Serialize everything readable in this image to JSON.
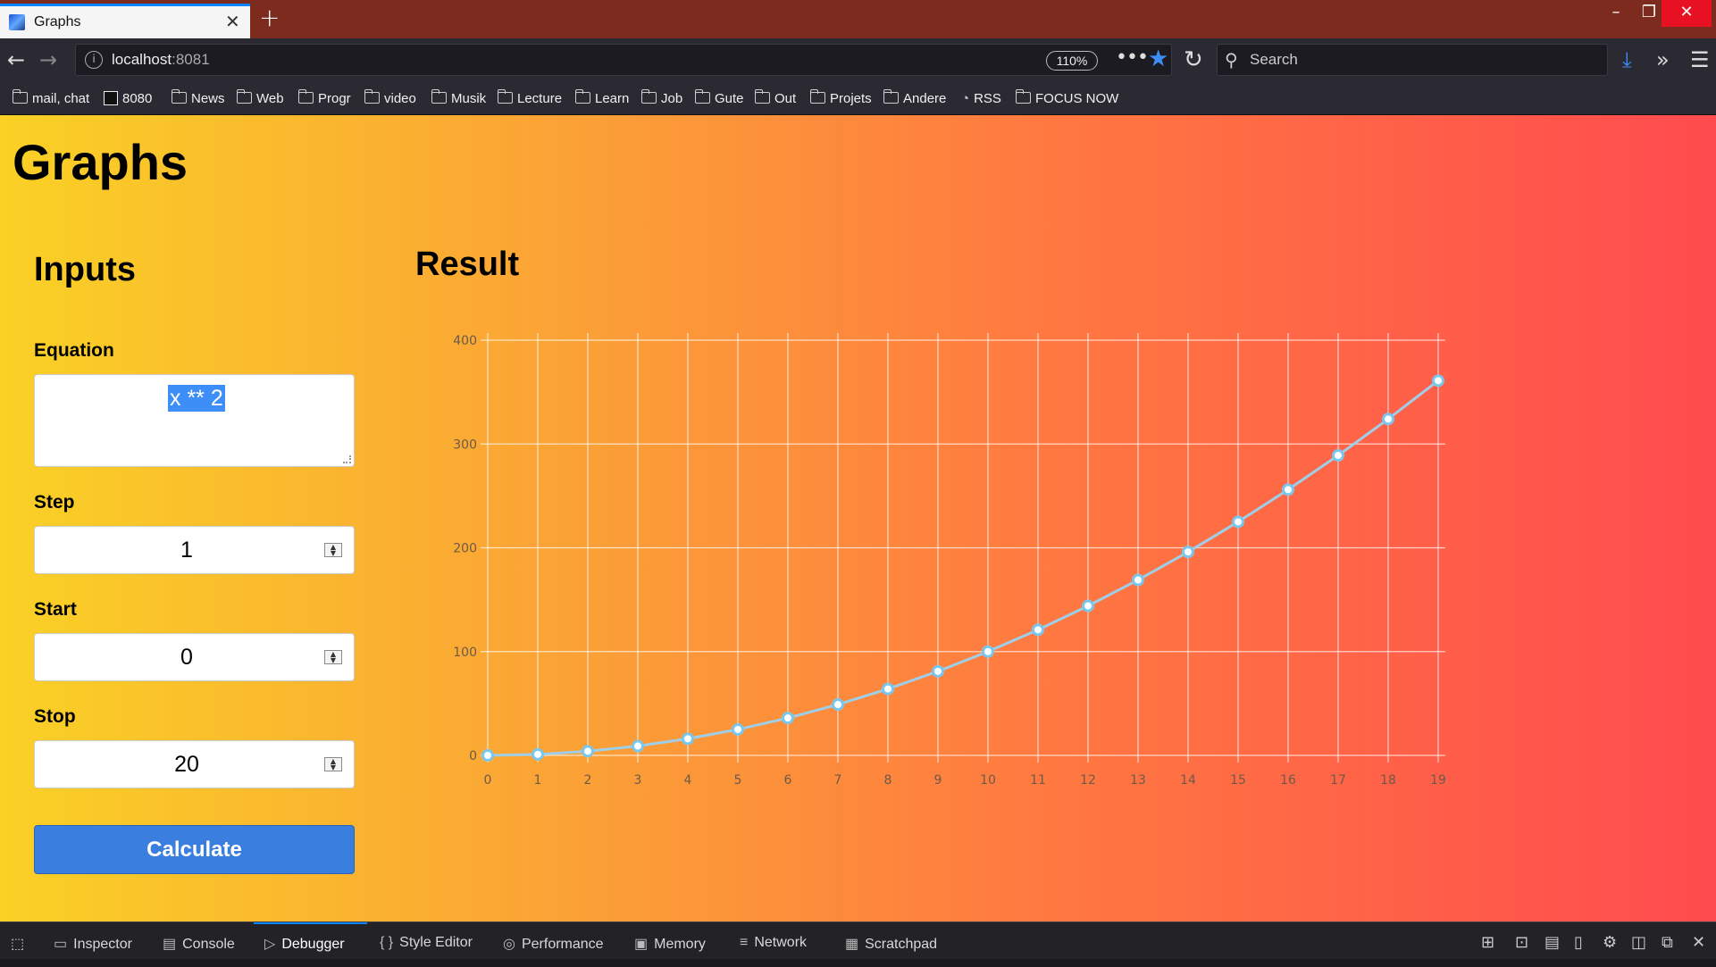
{
  "browser": {
    "tab_title": "Graphs",
    "url_host": "localhost",
    "url_port": ":8081",
    "zoom": "110%",
    "search_placeholder": "Search",
    "bookmarks": [
      "mail, chat",
      "8080",
      "News",
      "Web",
      "Progr",
      "video",
      "Musik",
      "Lecture",
      "Learn",
      "Job",
      "Gute",
      "Out",
      "Projets",
      "Andere",
      "RSS",
      "FOCUS NOW"
    ]
  },
  "page": {
    "title": "Graphs",
    "inputs_title": "Inputs",
    "result_title": "Result",
    "equation_label": "Equation",
    "equation_value": "x ** 2",
    "step_label": "Step",
    "step_value": "1",
    "start_label": "Start",
    "start_value": "0",
    "stop_label": "Stop",
    "stop_value": "20",
    "calculate_label": "Calculate"
  },
  "chart_data": {
    "type": "line",
    "x": [
      0,
      1,
      2,
      3,
      4,
      5,
      6,
      7,
      8,
      9,
      10,
      11,
      12,
      13,
      14,
      15,
      16,
      17,
      18,
      19
    ],
    "values": [
      0,
      1,
      4,
      9,
      16,
      25,
      36,
      49,
      64,
      81,
      100,
      121,
      144,
      169,
      196,
      225,
      256,
      289,
      324,
      361
    ],
    "ylim": [
      0,
      400
    ],
    "yticks": [
      0,
      100,
      200,
      300,
      400
    ],
    "grid": true,
    "line_color": "#9fcfe8",
    "point_fill": "#ffffff",
    "point_stroke": "#79c7ec"
  },
  "devtools": {
    "tabs": [
      "Inspector",
      "Console",
      "Debugger",
      "Style Editor",
      "Performance",
      "Memory",
      "Network",
      "Scratchpad"
    ],
    "active": "Debugger"
  }
}
